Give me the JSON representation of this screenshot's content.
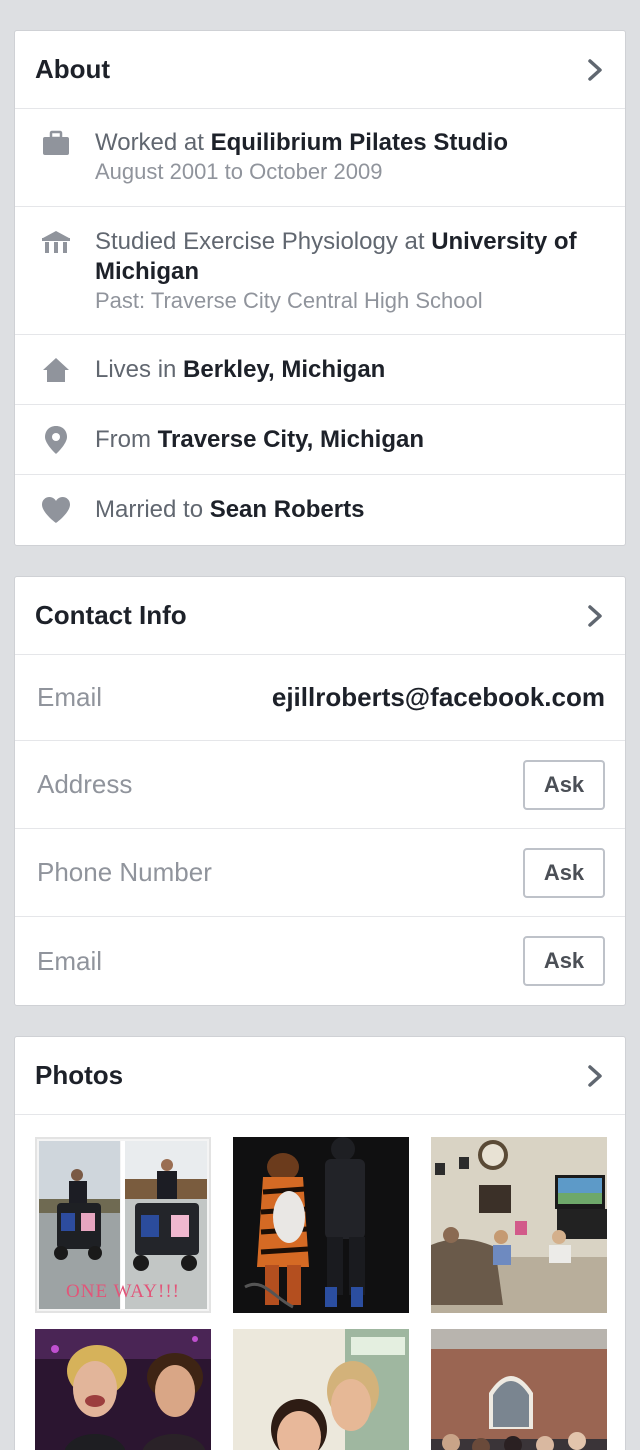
{
  "about": {
    "title": "About",
    "work": {
      "prefix": "Worked at ",
      "place": "Equilibrium Pilates Studio",
      "dates": "August 2001 to October 2009"
    },
    "education": {
      "prefix": "Studied Exercise Physiology at ",
      "place": "University of Michigan",
      "past": "Past: Traverse City Central High School"
    },
    "lives": {
      "prefix": "Lives in ",
      "place": "Berkley, Michigan"
    },
    "from": {
      "prefix": "From ",
      "place": "Traverse City, Michigan"
    },
    "married": {
      "prefix": "Married to ",
      "person": "Sean Roberts"
    }
  },
  "contact": {
    "title": "Contact Info",
    "email_label": "Email",
    "email_value": "ejillroberts@facebook.com",
    "rows": [
      {
        "label": "Address",
        "button": "Ask"
      },
      {
        "label": "Phone Number",
        "button": "Ask"
      },
      {
        "label": "Email",
        "button": "Ask"
      }
    ]
  },
  "photos": {
    "title": "Photos",
    "caption_1": "ONE WAY!!!"
  },
  "colors": {
    "background": "#dddfe2",
    "card": "#ffffff",
    "text_dark": "#1d2129",
    "text_muted": "#616770",
    "text_light": "#90949c",
    "icon": "#90949c"
  }
}
